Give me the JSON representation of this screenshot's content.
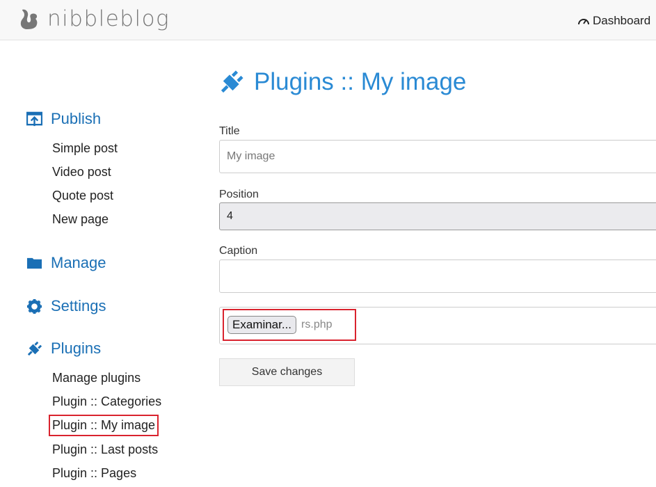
{
  "header": {
    "logo": "nibbleblog",
    "dashboard": "Dashboard"
  },
  "sidebar": {
    "publish": {
      "label": "Publish",
      "items": [
        "Simple post",
        "Video post",
        "Quote post",
        "New page"
      ]
    },
    "manage": {
      "label": "Manage"
    },
    "settings": {
      "label": "Settings"
    },
    "plugins": {
      "label": "Plugins",
      "items": [
        "Manage plugins",
        "Plugin :: Categories",
        "Plugin :: My image",
        "Plugin :: Last posts",
        "Plugin :: Pages"
      ]
    }
  },
  "main": {
    "title": "Plugins :: My image",
    "title_label": "Title",
    "title_value": "My image",
    "position_label": "Position",
    "position_value": "4",
    "caption_label": "Caption",
    "caption_value": "",
    "file_button": "Examinar...",
    "file_name": "rs.php",
    "save": "Save changes"
  },
  "colors": {
    "accent": "#1a6fb5",
    "highlight": "#d9232e"
  }
}
